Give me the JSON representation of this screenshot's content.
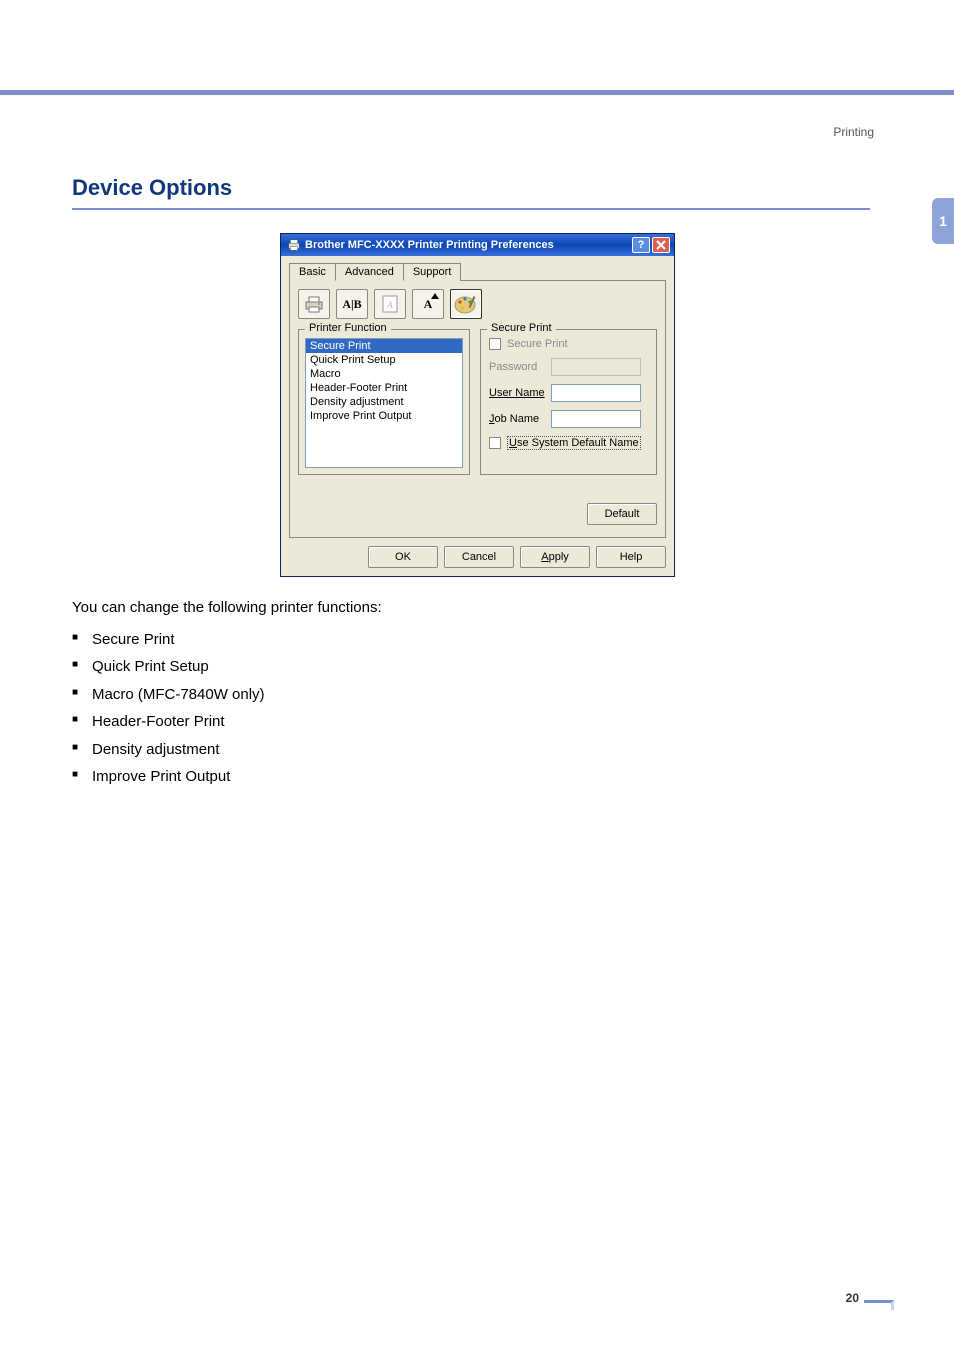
{
  "breadcrumb": "Printing",
  "side_tab": "1",
  "page_number": "20",
  "section_title": "Device Options",
  "dialog": {
    "title": "Brother MFC-XXXX Printer Printing Preferences",
    "tabs": {
      "basic": "Basic",
      "advanced": "Advanced",
      "support": "Support"
    },
    "printer_function": {
      "legend": "Printer Function",
      "items": [
        "Secure Print",
        "Quick Print Setup",
        "Macro",
        "Header-Footer Print",
        "Density adjustment",
        "Improve Print Output"
      ],
      "selected_index": 0
    },
    "secure_print_panel": {
      "legend": "Secure Print",
      "secure_print_label": "Secure Print",
      "password_label": "Password",
      "user_name_label": "User Name",
      "job_name_label": "Job Name",
      "use_system_default_access": "U",
      "use_system_default_rest": "se System Default Name"
    },
    "buttons": {
      "default": "Default",
      "ok": "OK",
      "cancel": "Cancel",
      "apply_access": "A",
      "apply_rest": "pply",
      "help": "Help"
    }
  },
  "body": {
    "intro": "You can change the following printer functions:",
    "items": [
      "Secure Print",
      "Quick Print Setup",
      "Macro (MFC-7840W only)",
      "Header-Footer Print",
      "Density adjustment",
      "Improve Print Output"
    ]
  }
}
